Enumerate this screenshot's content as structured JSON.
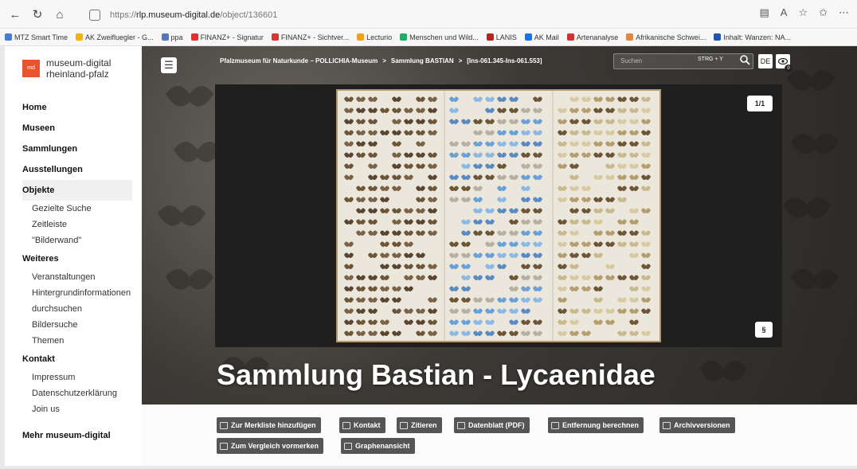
{
  "browser": {
    "url_prefix": "https://",
    "url_host": "rlp.museum-digital.de",
    "url_path": "/object/136601"
  },
  "bookmarks": [
    {
      "label": "MTZ Smart Time",
      "color": "#4a7bd1"
    },
    {
      "label": "AK Zweifluegler - G...",
      "color": "#f2b400"
    },
    {
      "label": "ppa",
      "color": "#5577bb"
    },
    {
      "label": "FINANZ+ - Signatur",
      "color": "#d33"
    },
    {
      "label": "FINANZ+ - Sichtver...",
      "color": "#d33"
    },
    {
      "label": "Lecturio",
      "color": "#f0a020"
    },
    {
      "label": "Menschen und Wild...",
      "color": "#2a6"
    },
    {
      "label": "LANIS",
      "color": "#b22"
    },
    {
      "label": "AK Mail",
      "color": "#1a73e8"
    },
    {
      "label": "Artenanalyse",
      "color": "#c33"
    },
    {
      "label": "Afrikanische Schwei...",
      "color": "#d84"
    },
    {
      "label": "Inhalt: Wanzen: NA...",
      "color": "#25a"
    }
  ],
  "sidebar": {
    "logo_line1": "museum-digital",
    "logo_line2": "rheinland-pfalz",
    "logo_mark": "md",
    "nav": [
      {
        "label": "Home",
        "type": "main"
      },
      {
        "label": "Museen",
        "type": "main"
      },
      {
        "label": "Sammlungen",
        "type": "main"
      },
      {
        "label": "Ausstellungen",
        "type": "main"
      },
      {
        "label": "Objekte",
        "type": "main",
        "active": true
      },
      {
        "label": "Gezielte Suche",
        "type": "sub"
      },
      {
        "label": "Zeitleiste",
        "type": "sub"
      },
      {
        "label": "\"Bilderwand\"",
        "type": "sub"
      },
      {
        "label": "Weiteres",
        "type": "main"
      },
      {
        "label": "Veranstaltungen",
        "type": "sub"
      },
      {
        "label": "Hintergrundinformationen",
        "type": "sub"
      },
      {
        "label": "durchsuchen",
        "type": "sub"
      },
      {
        "label": "Bildersuche",
        "type": "sub"
      },
      {
        "label": "Themen",
        "type": "sub"
      },
      {
        "label": "Kontakt",
        "type": "main"
      },
      {
        "label": "Impressum",
        "type": "sub"
      },
      {
        "label": "Datenschutzerklärung",
        "type": "sub"
      },
      {
        "label": "Join us",
        "type": "sub"
      }
    ],
    "footer_link": "Mehr museum-digital"
  },
  "header": {
    "breadcrumb": [
      "Pfalzmuseum für Naturkunde – POLLICHIA-Museum",
      "Sammlung BASTIAN",
      "[Ins-061.345-Ins-061.553]"
    ],
    "breadcrumb_separator": ">",
    "search_placeholder": "Suchen",
    "search_shortcut": "STRG + Y",
    "language": "DE",
    "watch_count": "0"
  },
  "viewer": {
    "counter": "1/1",
    "license_symbol": "§"
  },
  "title": "Sammlung Bastian - Lycaenidae",
  "actions": [
    {
      "label": "Zur Merkliste hinzufügen"
    },
    {
      "label": "Kontakt"
    },
    {
      "label": "Zitieren"
    },
    {
      "label": "Datenblatt (PDF)"
    },
    {
      "label": "Entfernung berechnen"
    },
    {
      "label": "Archivversionen"
    },
    {
      "label": "Zum Vergleich vormerken"
    },
    {
      "label": "Graphenansicht"
    }
  ],
  "colors": {
    "accent": "#e8542d",
    "button_bg": "#555555"
  }
}
